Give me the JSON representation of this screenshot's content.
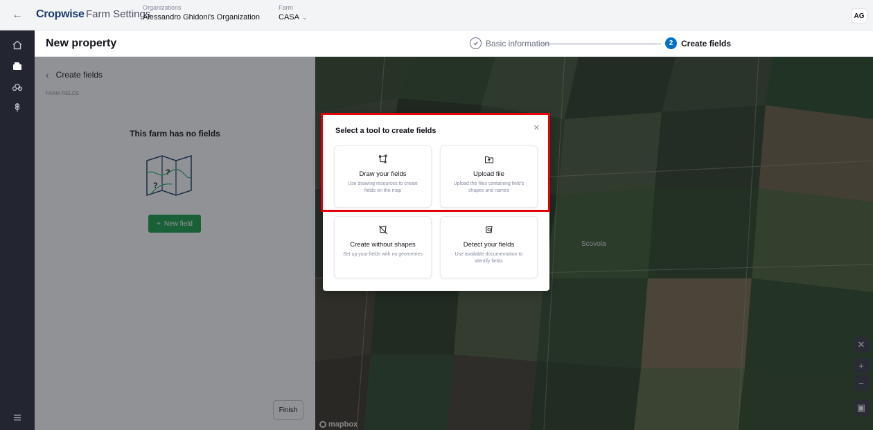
{
  "topbar": {
    "back_icon": "arrow-left-icon",
    "brand": "Cropwise",
    "app_title": "Farm Settings",
    "org_label": "Organizations",
    "org_value": "Alessandro Ghidoni's Organization",
    "farm_label": "Farm",
    "farm_value": "CASA",
    "user_initials": "AG"
  },
  "rail": {
    "items": [
      "home-icon",
      "property-icon",
      "machinery-icon",
      "crop-icon",
      "menu-icon"
    ]
  },
  "header": {
    "title": "New property",
    "step1_label": "Basic information",
    "step2_number": "2",
    "step2_label": "Create fields"
  },
  "panel": {
    "back_label": "Create fields",
    "section_label": "FARM FIELDS",
    "empty_title": "This farm has no fields",
    "new_field_label": "New field",
    "finish_label": "Finish"
  },
  "map": {
    "place_label": "Scovola",
    "attribution": "mapbox"
  },
  "modal": {
    "title": "Select a tool to create fields",
    "tools": [
      {
        "title": "Draw your fields",
        "desc": "Use drawing resources to create fields on the map",
        "icon": "draw-polygon-icon"
      },
      {
        "title": "Upload file",
        "desc": "Upload the files containing field's shapes and names",
        "icon": "upload-folder-icon"
      },
      {
        "title": "Create without shapes",
        "desc": "Set up your fields with no geometries",
        "icon": "no-shape-icon"
      },
      {
        "title": "Detect your fields",
        "desc": "Use available documentation to identify fields",
        "icon": "detect-fields-icon"
      }
    ]
  },
  "colors": {
    "accent": "#0071cd",
    "primary_button": "#19a04b",
    "highlight": "#e3000b"
  }
}
